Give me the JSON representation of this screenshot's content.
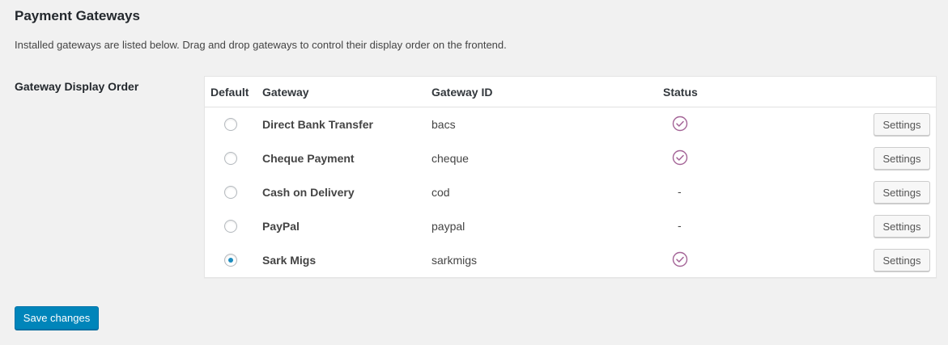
{
  "page": {
    "title": "Payment Gateways",
    "description": "Installed gateways are listed below. Drag and drop gateways to control their display order on the frontend."
  },
  "field_label": "Gateway Display Order",
  "colors": {
    "accent": "#0085ba",
    "radio_selected": "#1e8cbe",
    "status_enabled": "#a46497"
  },
  "table": {
    "headers": {
      "default": "Default",
      "gateway": "Gateway",
      "gateway_id": "Gateway ID",
      "status": "Status"
    },
    "rows": [
      {
        "name": "Direct Bank Transfer",
        "id": "bacs",
        "default": false,
        "status": "enabled",
        "status_text": "",
        "settings_label": "Settings"
      },
      {
        "name": "Cheque Payment",
        "id": "cheque",
        "default": false,
        "status": "enabled",
        "status_text": "",
        "settings_label": "Settings"
      },
      {
        "name": "Cash on Delivery",
        "id": "cod",
        "default": false,
        "status": "disabled",
        "status_text": "-",
        "settings_label": "Settings"
      },
      {
        "name": "PayPal",
        "id": "paypal",
        "default": false,
        "status": "disabled",
        "status_text": "-",
        "settings_label": "Settings"
      },
      {
        "name": "Sark Migs",
        "id": "sarkmigs",
        "default": true,
        "status": "enabled",
        "status_text": "",
        "settings_label": "Settings"
      }
    ],
    "status_icon": "check-circle-icon"
  },
  "save_label": "Save changes"
}
